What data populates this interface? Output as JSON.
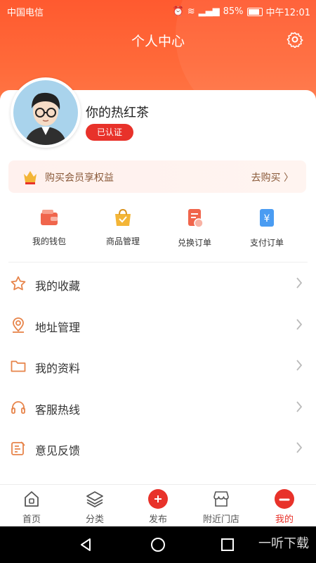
{
  "status_bar": {
    "carrier": "中国电信",
    "battery": "85%",
    "time": "中午12:01"
  },
  "header": {
    "title": "个人中心"
  },
  "profile": {
    "username": "你的热红茶",
    "badge": "已认证"
  },
  "vip": {
    "text": "购买会员享权益",
    "action": "去购买 〉"
  },
  "shortcuts": [
    {
      "label": "我的钱包",
      "icon": "wallet-icon",
      "color": "#f0654c"
    },
    {
      "label": "商品管理",
      "icon": "bag-icon",
      "color": "#f3b537"
    },
    {
      "label": "兑换订单",
      "icon": "exchange-order-icon",
      "color": "#f0654c"
    },
    {
      "label": "支付订单",
      "icon": "payment-order-icon",
      "color": "#4a9cf2"
    }
  ],
  "menu": [
    {
      "label": "我的收藏",
      "icon": "star-icon"
    },
    {
      "label": "地址管理",
      "icon": "location-icon"
    },
    {
      "label": "我的资料",
      "icon": "folder-icon"
    },
    {
      "label": "客服热线",
      "icon": "headset-icon"
    },
    {
      "label": "意见反馈",
      "icon": "feedback-icon"
    }
  ],
  "tabbar": [
    {
      "label": "首页",
      "icon": "home-icon"
    },
    {
      "label": "分类",
      "icon": "layers-icon"
    },
    {
      "label": "发布",
      "icon": "plus-icon"
    },
    {
      "label": "附近门店",
      "icon": "store-icon"
    },
    {
      "label": "我的",
      "icon": "profile-icon",
      "active": true
    }
  ],
  "watermark": "一听下载",
  "colors": {
    "accent": "#ff5a2f",
    "badge_red": "#e8322a",
    "icon_orange": "#e7844a"
  }
}
